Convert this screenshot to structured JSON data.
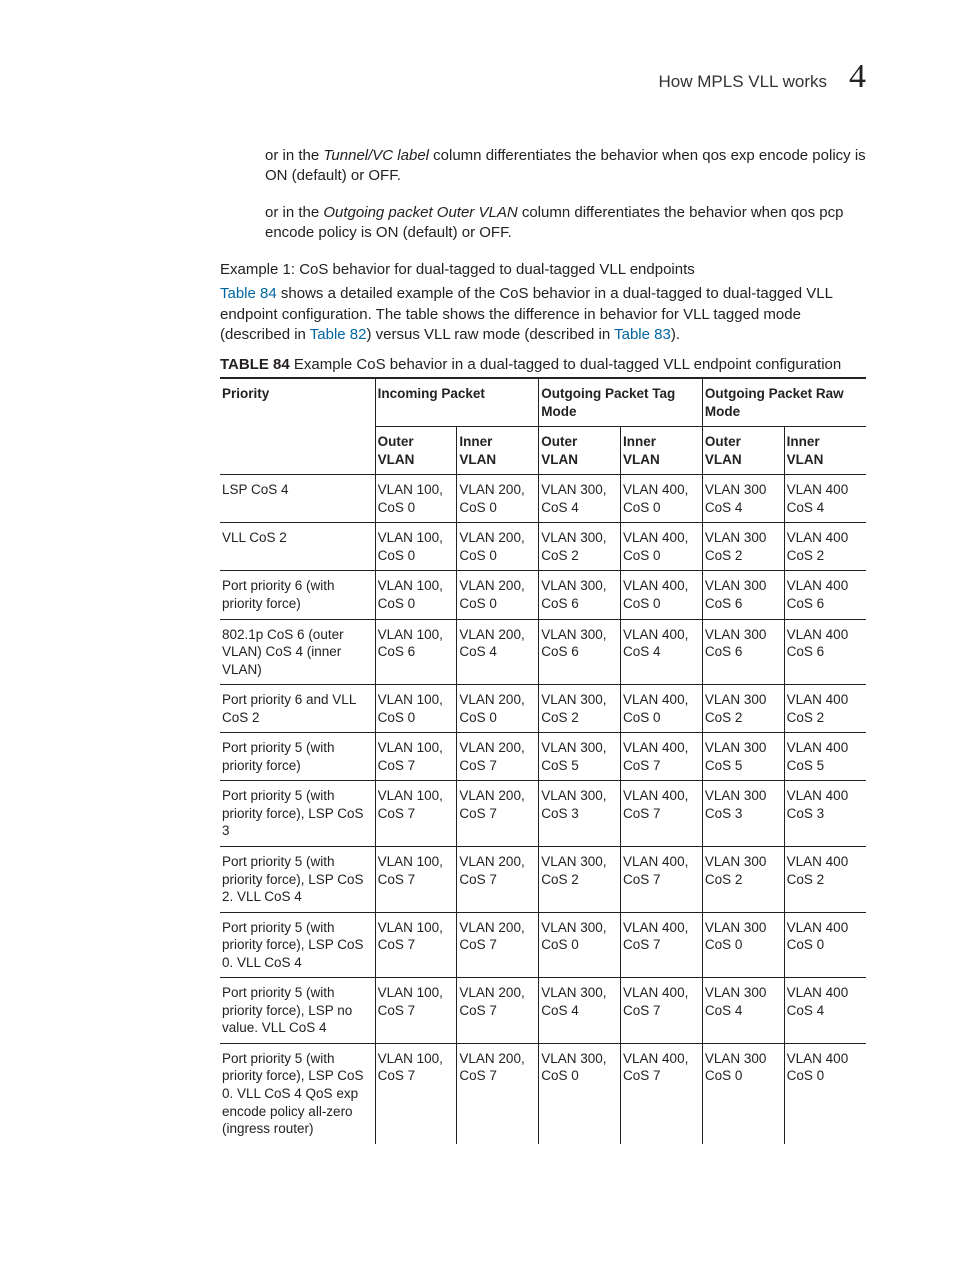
{
  "header": {
    "title": "How MPLS VLL works",
    "chapter": "4"
  },
  "paras": {
    "p1_pre": "or in the ",
    "p1_ital": "Tunnel/VC label",
    "p1_post": " column differentiates the behavior when qos exp encode policy is ON (default) or OFF.",
    "p2_pre": "or in the ",
    "p2_ital": "Outgoing packet Outer VLAN",
    "p2_post": " column differentiates the behavior when qos pcp encode policy is ON (default) or OFF."
  },
  "section": {
    "title": "Example 1: CoS behavior for dual-tagged to dual-tagged VLL endpoints",
    "intro_a": "Table 84",
    "intro_b": " shows a detailed example of the CoS behavior in a dual-tagged to dual-tagged VLL endpoint configuration. The table shows the difference in behavior for VLL tagged mode (described in ",
    "intro_c": "Table 82",
    "intro_d": ") versus VLL raw mode (described in ",
    "intro_e": "Table 83",
    "intro_f": ")."
  },
  "table": {
    "caption_bold": "TABLE 84",
    "caption_rest": " Example CoS behavior in a dual-tagged to dual-tagged VLL endpoint configuration",
    "headers": {
      "priority": "Priority",
      "incoming": "Incoming Packet",
      "out_tag": "Outgoing Packet Tag Mode",
      "out_raw": "Outgoing Packet Raw Mode",
      "outer_vlan": "Outer VLAN",
      "inner_vlan": "Inner VLAN"
    },
    "rows": [
      {
        "p": "LSP CoS 4",
        "c": [
          "VLAN 100, CoS 0",
          "VLAN 200, CoS 0",
          "VLAN 300, CoS 4",
          "VLAN 400, CoS 0",
          "VLAN 300 CoS 4",
          "VLAN 400 CoS 4"
        ]
      },
      {
        "p": "VLL CoS 2",
        "c": [
          "VLAN 100, CoS 0",
          "VLAN 200, CoS 0",
          "VLAN 300, CoS 2",
          "VLAN 400, CoS 0",
          "VLAN 300 CoS 2",
          "VLAN 400 CoS 2"
        ]
      },
      {
        "p": "Port priority 6 (with priority force)",
        "c": [
          "VLAN 100, CoS 0",
          "VLAN 200, CoS 0",
          "VLAN 300, CoS 6",
          "VLAN 400, CoS 0",
          "VLAN 300 CoS 6",
          "VLAN 400 CoS 6"
        ]
      },
      {
        "p": "802.1p CoS 6 (outer VLAN) CoS 4 (inner VLAN)",
        "c": [
          "VLAN 100, CoS 6",
          "VLAN 200, CoS 4",
          "VLAN 300, CoS 6",
          "VLAN 400, CoS 4",
          "VLAN 300 CoS 6",
          "VLAN 400 CoS 6"
        ]
      },
      {
        "p": "Port priority 6 and VLL CoS 2",
        "c": [
          "VLAN 100, CoS 0",
          "VLAN 200, CoS 0",
          "VLAN 300, CoS 2",
          "VLAN 400, CoS 0",
          "VLAN 300 CoS 2",
          "VLAN 400 CoS 2"
        ]
      },
      {
        "p": "Port priority 5 (with priority force)",
        "c": [
          "VLAN 100, CoS 7",
          "VLAN 200, CoS 7",
          "VLAN 300, CoS 5",
          "VLAN 400, CoS 7",
          "VLAN 300 CoS 5",
          "VLAN 400 CoS 5"
        ]
      },
      {
        "p": "Port priority 5 (with priority force), LSP CoS 3",
        "c": [
          "VLAN 100, CoS 7",
          "VLAN 200, CoS 7",
          "VLAN 300, CoS 3",
          "VLAN 400, CoS 7",
          "VLAN 300 CoS 3",
          "VLAN 400 CoS 3"
        ]
      },
      {
        "p": "Port priority 5 (with priority force), LSP CoS 2. VLL CoS 4",
        "c": [
          "VLAN 100, CoS 7",
          "VLAN 200, CoS 7",
          "VLAN 300, CoS 2",
          "VLAN 400, CoS 7",
          "VLAN 300 CoS 2",
          "VLAN 400 CoS 2"
        ]
      },
      {
        "p": "Port priority 5 (with priority force), LSP CoS 0. VLL CoS 4",
        "c": [
          "VLAN 100, CoS 7",
          "VLAN 200, CoS 7",
          "VLAN 300, CoS 0",
          "VLAN 400, CoS 7",
          "VLAN 300 CoS 0",
          "VLAN 400 CoS 0"
        ]
      },
      {
        "p": "Port priority 5 (with priority force), LSP no value. VLL CoS 4",
        "c": [
          "VLAN 100, CoS 7",
          "VLAN 200, CoS 7",
          "VLAN 300, CoS 4",
          "VLAN 400, CoS 7",
          "VLAN 300 CoS 4",
          "VLAN 400 CoS 4"
        ]
      },
      {
        "p": "Port priority 5 (with priority force), LSP CoS 0. VLL CoS 4 QoS exp encode policy all-zero (ingress router)",
        "c": [
          "VLAN 100, CoS 7",
          "VLAN 200, CoS 7",
          "VLAN 300, CoS 0",
          "VLAN 400, CoS 7",
          "VLAN 300 CoS 0",
          "VLAN 400 CoS 0"
        ]
      }
    ]
  }
}
